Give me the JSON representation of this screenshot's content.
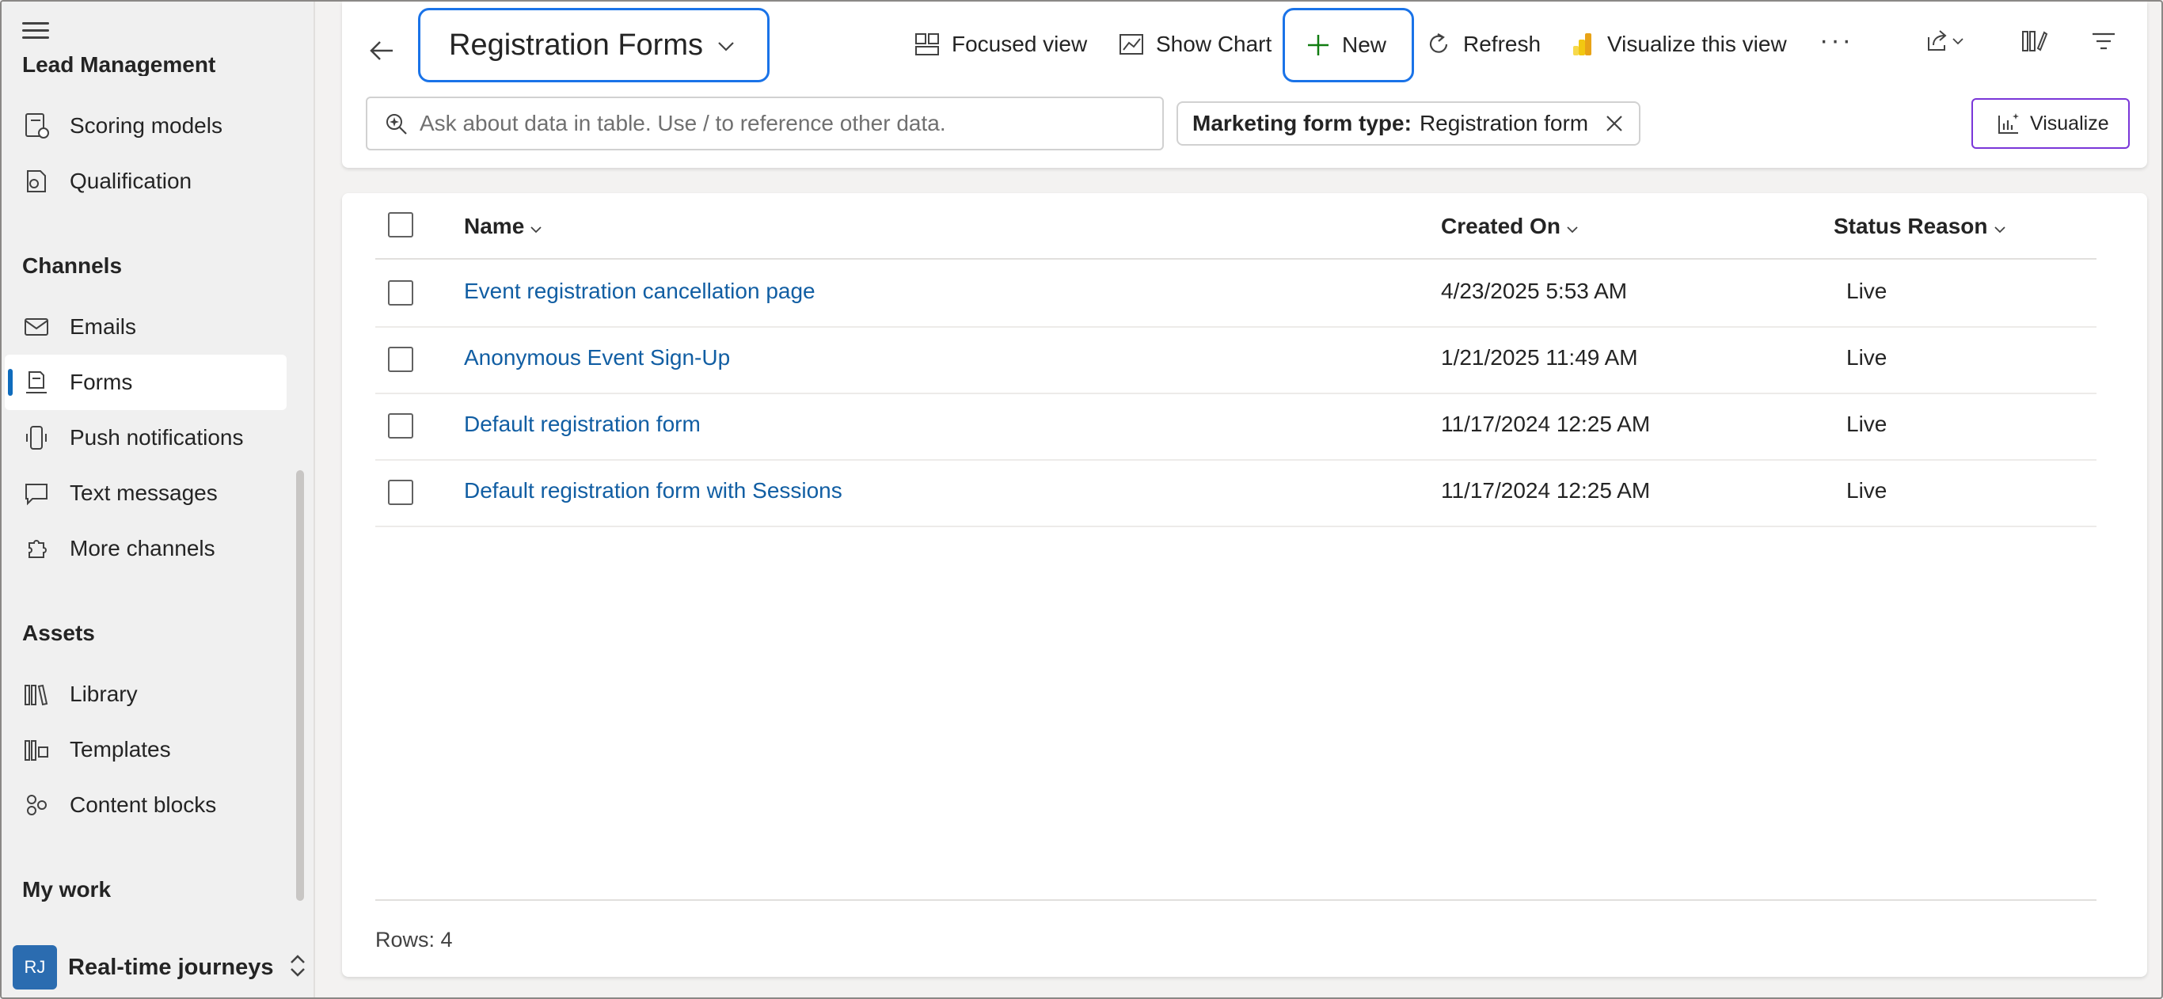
{
  "sidebar": {
    "partial_section_title": "Lead Management",
    "lead_items": [
      {
        "label": "Scoring models",
        "icon": "scoring-models-icon"
      },
      {
        "label": "Qualification",
        "icon": "qualification-icon"
      }
    ],
    "channels_title": "Channels",
    "channel_items": [
      {
        "label": "Emails",
        "icon": "mail-icon"
      },
      {
        "label": "Forms",
        "icon": "form-icon",
        "active": true
      },
      {
        "label": "Push notifications",
        "icon": "phone-icon"
      },
      {
        "label": "Text messages",
        "icon": "chat-icon"
      },
      {
        "label": "More channels",
        "icon": "puzzle-icon"
      }
    ],
    "assets_title": "Assets",
    "asset_items": [
      {
        "label": "Library",
        "icon": "library-icon"
      },
      {
        "label": "Templates",
        "icon": "templates-icon"
      },
      {
        "label": "Content blocks",
        "icon": "content-blocks-icon"
      }
    ],
    "mywork_title": "My work",
    "area": {
      "initials": "RJ",
      "label": "Real-time journeys"
    }
  },
  "toolbar": {
    "view_title": "Registration Forms",
    "focused_view": "Focused view",
    "show_chart": "Show Chart",
    "new": "New",
    "refresh": "Refresh",
    "visualize_view": "Visualize this view",
    "more": "···"
  },
  "search": {
    "placeholder": "Ask about data in table. Use / to reference other data."
  },
  "filter": {
    "key": "Marketing form type:",
    "value": "Registration form"
  },
  "visualize_button": "Visualize",
  "grid": {
    "columns": [
      "Name",
      "Created On",
      "Status Reason"
    ],
    "rows": [
      {
        "name": "Event registration cancellation page",
        "created": "4/23/2025 5:53 AM",
        "status": "Live"
      },
      {
        "name": "Anonymous Event Sign-Up",
        "created": "1/21/2025 11:49 AM",
        "status": "Live"
      },
      {
        "name": "Default registration form",
        "created": "11/17/2024 12:25 AM",
        "status": "Live"
      },
      {
        "name": "Default registration form with Sessions",
        "created": "11/17/2024 12:25 AM",
        "status": "Live"
      }
    ],
    "row_count": "Rows: 4"
  },
  "colors": {
    "accent": "#0f6cbd",
    "focus_outline": "#1a73e8",
    "link": "#115ea3",
    "new_plus": "#107c10",
    "visualize_border": "#7a36d8"
  }
}
